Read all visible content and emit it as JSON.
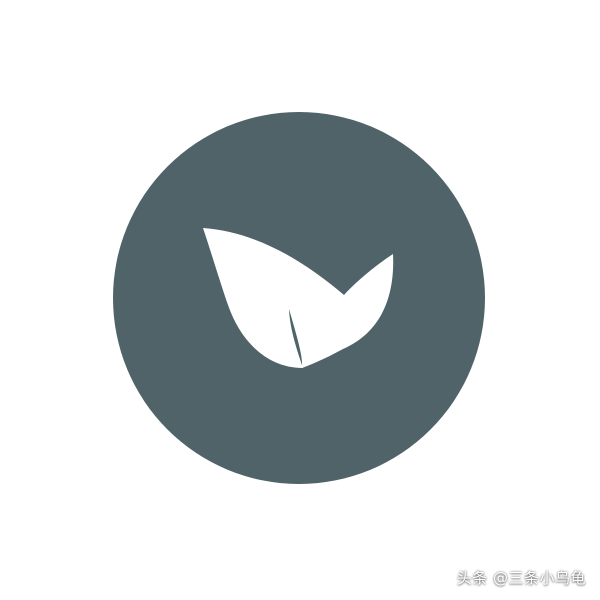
{
  "logo": {
    "icon": "leaf-icon",
    "circle_color": "#4f6369",
    "leaf_color": "#ffffff",
    "background_color": "#ffffff"
  },
  "watermark": {
    "text": "头条 @三条小乌龟"
  }
}
